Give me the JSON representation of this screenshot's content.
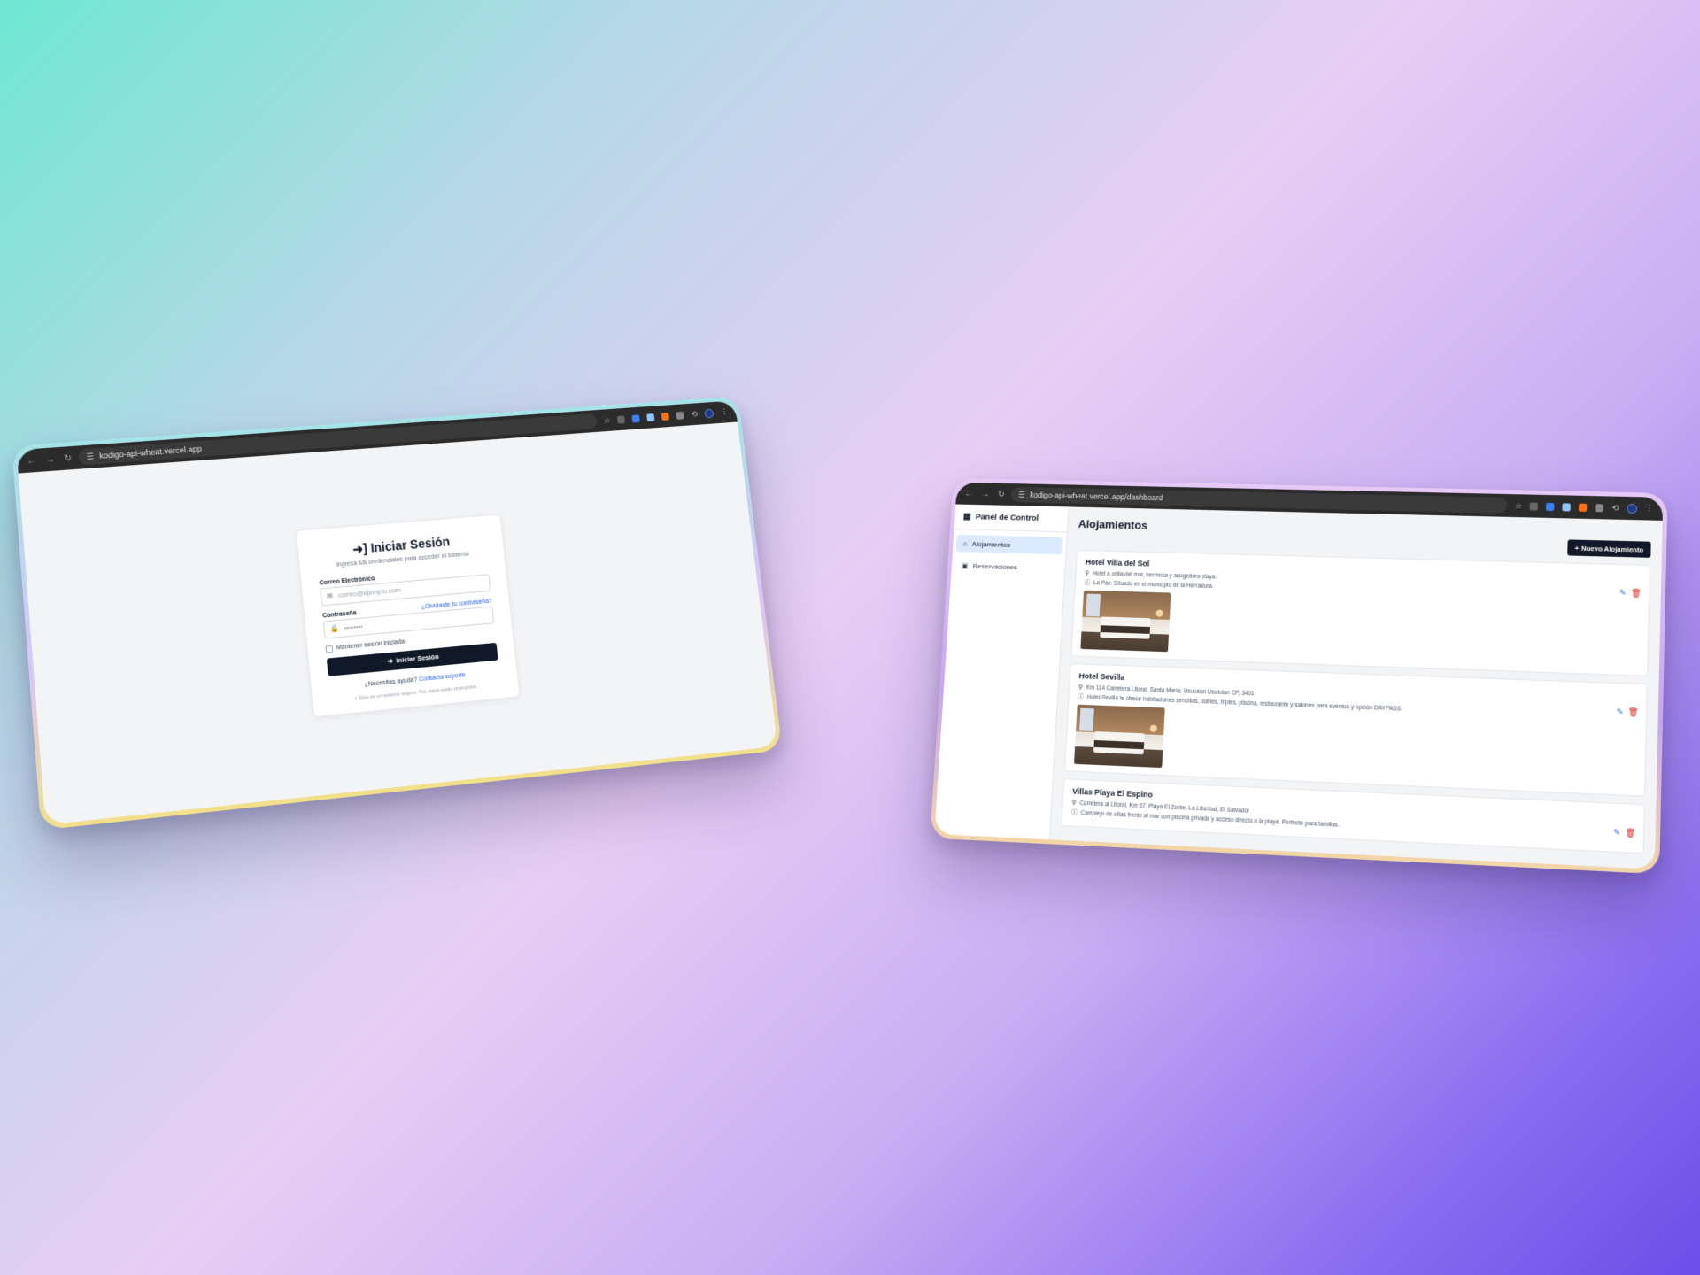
{
  "login_window": {
    "url": "kodigo-api-wheat.vercel.app",
    "title": "Iniciar Sesión",
    "subtitle": "Ingresa tus credenciales para acceder al sistema",
    "email_label": "Correo Electrónico",
    "email_placeholder": "correo@ejemplo.com",
    "password_label": "Contraseña",
    "forgot_link": "¿Olvidaste tu contraseña?",
    "password_value": "••••••••",
    "remember_label": "Mantener sesión iniciada",
    "submit_label": "Iniciar Sesión",
    "help_text": "¿Necesitas ayuda?",
    "help_link": "Contacta soporte",
    "secure_note": "Este es un sistema seguro. Tus datos están protegidos."
  },
  "dashboard_window": {
    "url": "kodigo-api-wheat.vercel.app/dashboard",
    "sidebar": {
      "title": "Panel de Control",
      "items": [
        {
          "label": "Alojamientos",
          "icon": "home-icon",
          "active": true
        },
        {
          "label": "Reservaciones",
          "icon": "calendar-icon",
          "active": false
        }
      ]
    },
    "page_title": "Alojamientos",
    "new_button": "Nuevo Alojamiento",
    "cards": [
      {
        "name": "Hotel Villa del Sol",
        "address": "Hotel a orilla del mar, hermosa y acogedora playa.",
        "description": "La Paz. Situado en el municipio de la Herradura."
      },
      {
        "name": "Hotel Sevilla",
        "address": "Km 114 Carretera Litoral, Santa María, Usulután Usulutan CP, 3401",
        "description": "Hotel Sevilla te ofrece habitaciones sencillas, dobles, triples, piscina, restaurante y salones para eventos y opción DAYPASS."
      },
      {
        "name": "Villas Playa El Espino",
        "address": "Carretera al Litoral, Km 67, Playa El Zonte, La Libertad, El Salvador",
        "description": "Complejo de villas frente al mar con piscina privada y acceso directo a la playa. Perfecto para familias."
      }
    ]
  },
  "colors": {
    "primary_button": "#111827",
    "link": "#2563eb",
    "delete": "#dc2626",
    "active_nav": "#dbeafe"
  }
}
